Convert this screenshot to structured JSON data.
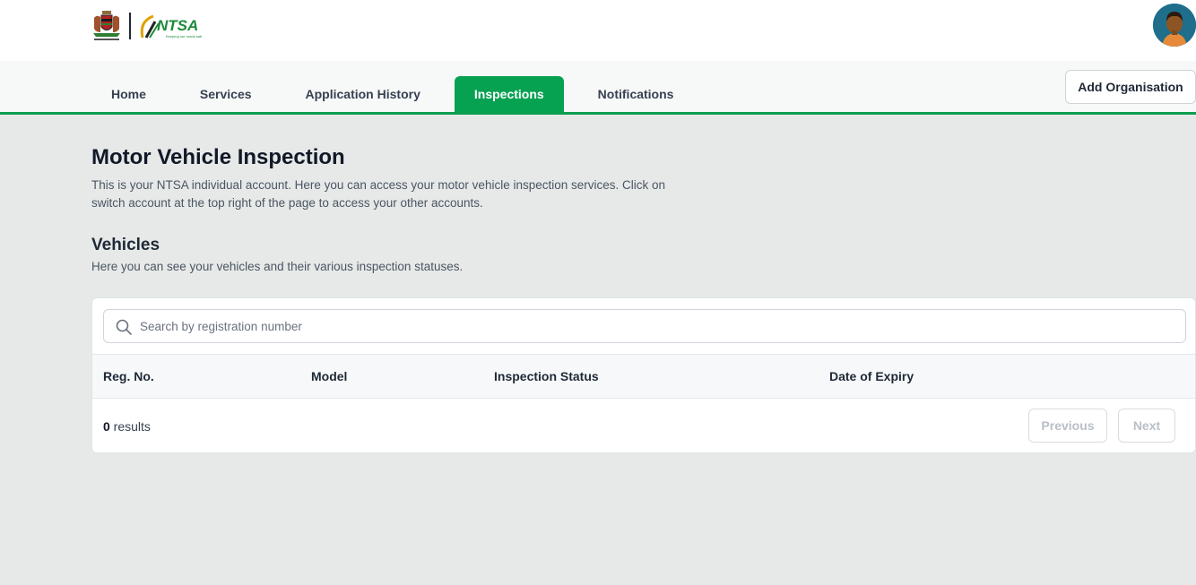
{
  "nav": {
    "tabs": [
      {
        "label": "Home",
        "active": false
      },
      {
        "label": "Services",
        "active": false
      },
      {
        "label": "Application History",
        "active": false
      },
      {
        "label": "Inspections",
        "active": true
      },
      {
        "label": "Notifications",
        "active": false
      }
    ],
    "add_organisation_label": "Add Organisation"
  },
  "page": {
    "title": "Motor Vehicle Inspection",
    "description": "This is your NTSA individual account. Here you can access your motor vehicle inspection services. Click on switch account at the top right of the page to access your other accounts."
  },
  "vehicles": {
    "title": "Vehicles",
    "description": "Here you can see your vehicles and their various inspection statuses.",
    "search_placeholder": "Search by registration number",
    "columns": [
      "Reg. No.",
      "Model",
      "Inspection Status",
      "Date of Expiry"
    ],
    "result_count": "0",
    "result_label": " results",
    "previous_label": "Previous",
    "next_label": "Next"
  },
  "icons": {
    "coat_of_arms": "kenya-coat-of-arms-icon",
    "ntsa_logo": "ntsa-logo",
    "avatar": "user-avatar",
    "search": "search-icon"
  },
  "colors": {
    "accent_green": "#07a152",
    "nav_underline": "#0d9e4f",
    "page_bg": "#e6e9e7",
    "avatar_bg": "#1f6e8c"
  }
}
